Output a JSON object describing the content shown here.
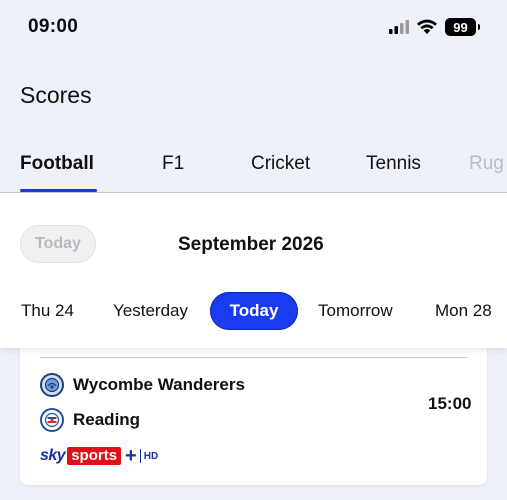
{
  "status_bar": {
    "time": "09:00",
    "battery": "99",
    "icons": [
      "signal-icon",
      "wifi-icon",
      "battery-icon"
    ]
  },
  "page": {
    "title": "Scores"
  },
  "sport_tabs": [
    {
      "label": "Football",
      "active": true
    },
    {
      "label": "F1",
      "active": false
    },
    {
      "label": "Cricket",
      "active": false
    },
    {
      "label": "Tennis",
      "active": false
    },
    {
      "label": "Rug",
      "active": false
    }
  ],
  "date_picker": {
    "today_button": "Today",
    "month": "September 2026",
    "days": [
      {
        "label": "Thu 24",
        "selected": false
      },
      {
        "label": "Yesterday",
        "selected": false
      },
      {
        "label": "Today",
        "selected": true
      },
      {
        "label": "Tomorrow",
        "selected": false
      },
      {
        "label": "Mon 28",
        "selected": false
      }
    ]
  },
  "match": {
    "home_team": "Wycombe Wanderers",
    "away_team": "Reading",
    "kickoff": "15:00",
    "broadcaster": {
      "sky": "sky",
      "sports": "sports",
      "plus": "+",
      "hd": "HD"
    }
  },
  "colors": {
    "accent": "#1a3cf0",
    "background": "#eef0fa",
    "sky_red": "#e0101a",
    "sky_blue": "#1c2f9e"
  }
}
